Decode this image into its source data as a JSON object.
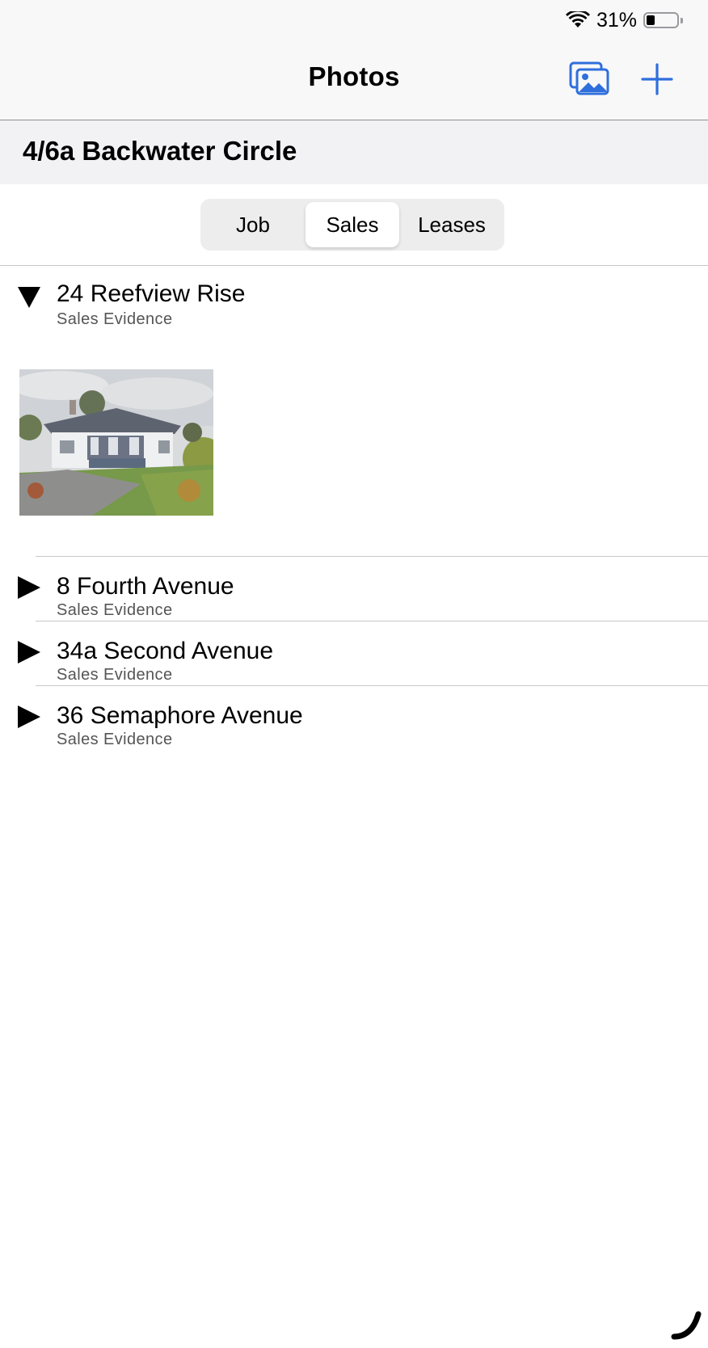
{
  "status_bar": {
    "battery_percent": "31%",
    "battery_level": 0.31,
    "icons": [
      "wifi-icon",
      "battery-icon"
    ]
  },
  "nav": {
    "title": "Photos",
    "buttons": [
      {
        "name": "photo-library-button",
        "icon": "photo-gallery-icon"
      },
      {
        "name": "add-button",
        "icon": "plus-icon"
      }
    ],
    "accent_color": "#2f6fdc"
  },
  "job": {
    "title": "4/6a Backwater Circle"
  },
  "segments": {
    "items": [
      "Job",
      "Sales",
      "Leases"
    ],
    "selected": "Sales"
  },
  "evidence_list": [
    {
      "title": "24 Reefview Rise",
      "subtitle": "Sales Evidence",
      "expanded": true,
      "photos": [
        "house-photo"
      ]
    },
    {
      "title": "8 Fourth Avenue",
      "subtitle": "Sales Evidence",
      "expanded": false
    },
    {
      "title": "34a Second Avenue",
      "subtitle": "Sales Evidence",
      "expanded": false
    },
    {
      "title": "36 Semaphore Avenue",
      "subtitle": "Sales Evidence",
      "expanded": false
    }
  ]
}
